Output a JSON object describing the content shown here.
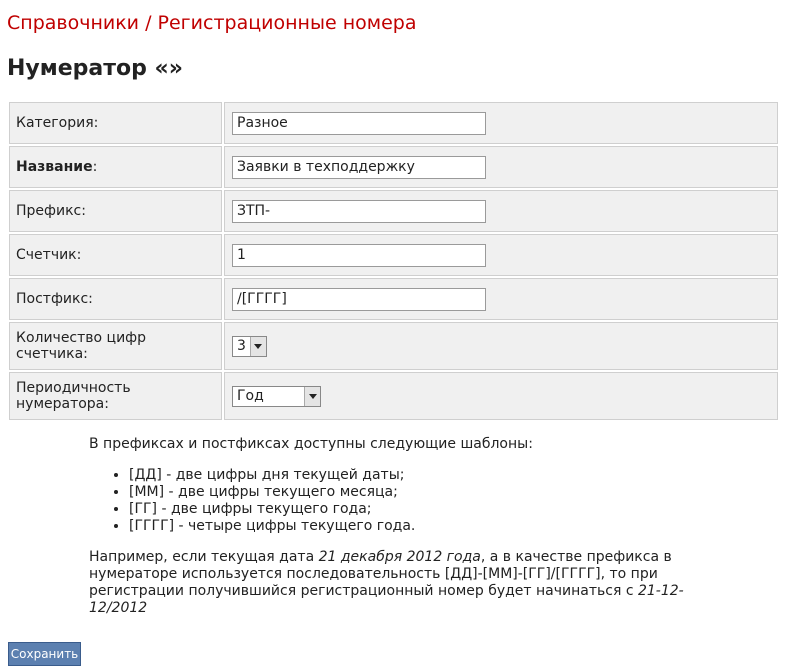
{
  "breadcrumb": {
    "section": "Справочники",
    "separator": " / ",
    "page": "Регистрационные номера"
  },
  "title": "Нумератор «»",
  "form": {
    "category": {
      "label": "Категория:",
      "value": "Разное"
    },
    "name": {
      "label_bold": "Название",
      "label_suffix": ":",
      "value": "Заявки в техподдержку"
    },
    "prefix": {
      "label": "Префикс:",
      "value": "ЗТП-"
    },
    "counter": {
      "label": "Счетчик:",
      "value": "1"
    },
    "postfix": {
      "label": "Постфикс:",
      "value": "/[ГГГГ]"
    },
    "digits": {
      "label": "Количество цифр счетчика:",
      "selected": "3"
    },
    "period": {
      "label": "Периодичность нумератора:",
      "selected": "Год"
    }
  },
  "help": {
    "intro": "В префиксах и постфиксах доступны следующие шаблоны:",
    "items": [
      "[ДД] - две цифры дня текущей даты;",
      "[ММ] - две цифры текущего месяца;",
      "[ГГ] - две цифры текущего года;",
      "[ГГГГ] - четыре цифры текущего года."
    ],
    "example_1": "Например, если текущая дата ",
    "example_date": "21 декабря 2012 года",
    "example_2": ", а в качестве префикса в нумераторе используется последовательность [ДД]-[ММ]-[ГГ]/[ГГГГ], то при регистрации получившийся регистрационный номер будет начинаться с ",
    "example_result": "21-12-12/2012"
  },
  "buttons": {
    "save": "Сохранить"
  }
}
